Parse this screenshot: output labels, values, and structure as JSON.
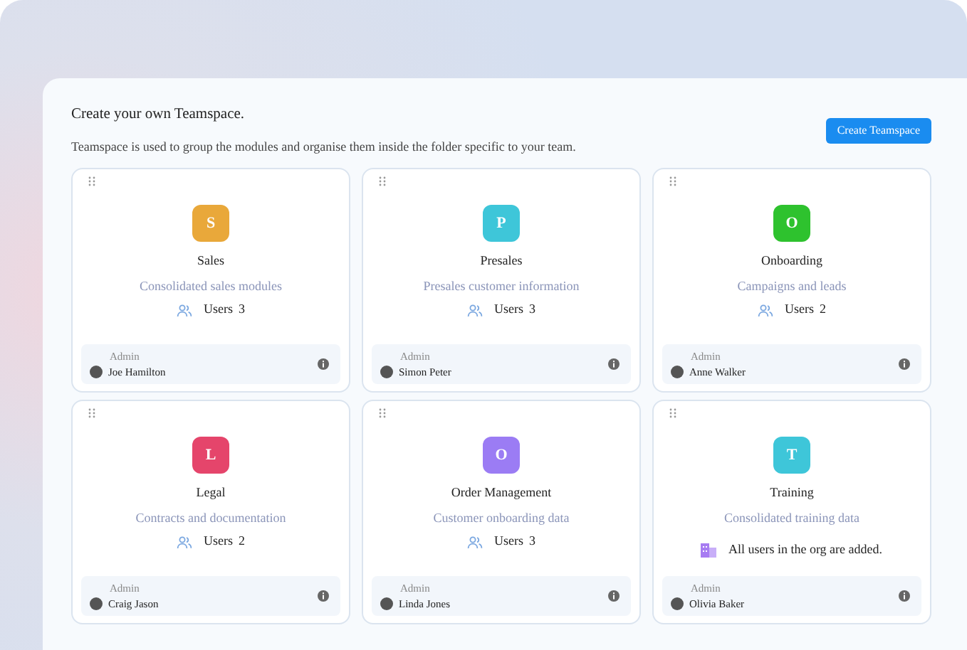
{
  "header": {
    "title": "Create your own Teamspace.",
    "description": "Teamspace is used to group the modules and organise them inside the folder specific to your team.",
    "button": "Create Teamspace"
  },
  "teams": [
    {
      "letter": "S",
      "color": "#e9a83a",
      "name": "Sales",
      "description": "Consolidated sales modules",
      "users": {
        "kind": "count",
        "label": "Users",
        "count": "3"
      },
      "admin_label": "Admin",
      "admin": "Joe Hamilton"
    },
    {
      "letter": "P",
      "color": "#3ec6d9",
      "name": "Presales",
      "description": "Presales customer information",
      "users": {
        "kind": "count",
        "label": "Users",
        "count": "3"
      },
      "admin_label": "Admin",
      "admin": "Simon Peter"
    },
    {
      "letter": "O",
      "color": "#2ec22e",
      "name": "Onboarding",
      "description": "Campaigns and leads",
      "users": {
        "kind": "count",
        "label": "Users",
        "count": "2"
      },
      "admin_label": "Admin",
      "admin": "Anne Walker"
    },
    {
      "letter": "L",
      "color": "#e5456b",
      "name": "Legal",
      "description": "Contracts and documentation",
      "users": {
        "kind": "count",
        "label": "Users",
        "count": "2"
      },
      "admin_label": "Admin",
      "admin": "Craig Jason"
    },
    {
      "letter": "O",
      "color": "#9b7cf4",
      "name": "Order Management",
      "description": "Customer onboarding data",
      "users": {
        "kind": "count",
        "label": "Users",
        "count": "3"
      },
      "admin_label": "Admin",
      "admin": "Linda Jones"
    },
    {
      "letter": "T",
      "color": "#3ec6d9",
      "name": "Training",
      "description": "Consolidated training data",
      "users": {
        "kind": "all",
        "text": "All users in the org are added."
      },
      "admin_label": "Admin",
      "admin": "Olivia Baker"
    }
  ]
}
